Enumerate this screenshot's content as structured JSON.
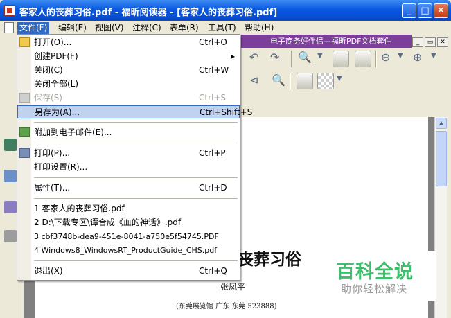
{
  "window": {
    "title": "客家人的丧葬习俗.pdf - 福昕阅读器 - [客家人的丧葬习俗.pdf]",
    "controls": [
      "_",
      "□",
      "✕"
    ]
  },
  "menubar": {
    "items": [
      "文件(F)",
      "编辑(E)",
      "视图(V)",
      "注释(C)",
      "表单(R)",
      "工具(T)",
      "帮助(H)"
    ],
    "mdi": [
      "_",
      "▭",
      "✕"
    ]
  },
  "promo": {
    "text": "电子商务好伴侣—福昕PDF文档套件"
  },
  "file_menu": {
    "items": [
      {
        "label": "打开(O)...",
        "shortcut": "Ctrl+O"
      },
      {
        "label": "创建PDF(F)",
        "shortcut": ""
      },
      {
        "label": "关闭(C)",
        "shortcut": "Ctrl+W"
      },
      {
        "label": "关闭全部(L)",
        "shortcut": ""
      },
      {
        "label": "保存(S)",
        "shortcut": "Ctrl+S"
      },
      {
        "label": "另存为(A)...",
        "shortcut": "Ctrl+Shift+S"
      },
      {
        "label": "附加到电子邮件(E)...",
        "shortcut": ""
      },
      {
        "label": "打印(P)...",
        "shortcut": "Ctrl+P"
      },
      {
        "label": "打印设置(R)...",
        "shortcut": ""
      },
      {
        "label": "属性(T)...",
        "shortcut": "Ctrl+D"
      },
      {
        "label": "1 客家人的丧葬习俗.pdf",
        "shortcut": ""
      },
      {
        "label": "2 D:\\下载专区\\谭合成《血的神话》.pdf",
        "shortcut": ""
      },
      {
        "label": "3 cbf3748b-dea9-451e-8041-a750e5f54745.PDF",
        "shortcut": ""
      },
      {
        "label": "4 Windows8_WindowsRT_ProductGuide_CHS.pdf",
        "shortcut": ""
      },
      {
        "label": "退出(X)",
        "shortcut": "Ctrl+Q"
      }
    ]
  },
  "document": {
    "heading": "丧葬习俗",
    "author": "张凤平",
    "affiliation": "(东莞展览馆  广东  东莞  523888)"
  },
  "watermark": {
    "title": "百科全说",
    "subtitle": "助你轻松解决"
  }
}
